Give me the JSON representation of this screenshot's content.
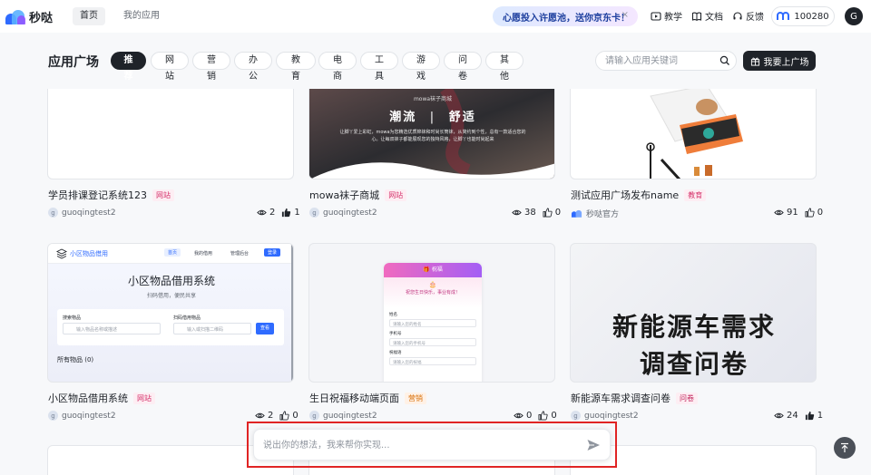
{
  "topbar": {
    "brand": "秒哒",
    "tabs": [
      {
        "label": "首页"
      },
      {
        "label": "我的应用"
      }
    ],
    "promo": "心愿投入许愿池，送你京东卡！",
    "promo_close": "×",
    "links": [
      {
        "label": "教学",
        "icon": "play-box-icon"
      },
      {
        "label": "文档",
        "icon": "book-icon"
      },
      {
        "label": "反馈",
        "icon": "headset-icon"
      }
    ],
    "credits": "100280",
    "avatar": "G"
  },
  "plaza": {
    "title": "应用广场",
    "categories": [
      {
        "label": "推荐"
      },
      {
        "label": "网站"
      },
      {
        "label": "营销"
      },
      {
        "label": "办公"
      },
      {
        "label": "教育"
      },
      {
        "label": "电商"
      },
      {
        "label": "工具"
      },
      {
        "label": "游戏"
      },
      {
        "label": "问卷"
      },
      {
        "label": "其他"
      }
    ],
    "search_placeholder": "请输入应用关键词",
    "cta": "我要上广场"
  },
  "cards": [
    {
      "title": "学员排课登记系统123",
      "tag": "网站",
      "author": "guoqingtest2",
      "views": "2",
      "likes": "1"
    },
    {
      "title": "mowa袜子商城",
      "tag": "网站",
      "author": "guoqingtest2",
      "views": "38",
      "likes": "0",
      "image_texts": {
        "small": "mowa袜子商城",
        "headline_left": "潮流",
        "headline_right": "舒适",
        "body": "让脚丫爱上彩虹，mowa为您精选优质棉袜和时尚长筒袜，从简约到个性，总有一款适合您的心。让每双袜子都能展现您的独特风格，让脚丫也能时尚起来"
      }
    },
    {
      "title": "测试应用广场发布name",
      "tag": "教育",
      "author": "秒哒官方",
      "views": "91",
      "likes": "0"
    },
    {
      "title": "小区物品借用系统",
      "tag": "网站",
      "author": "guoqingtest2",
      "views": "2",
      "likes": "0",
      "image_texts": {
        "app_name": "小区物品借用",
        "nav": [
          "首页",
          "我的借用",
          "管理后台",
          "登录"
        ],
        "heading": "小区物品借用系统",
        "subheading": "扫码借用，便民共享",
        "field1_label": "搜索物品",
        "field1_placeholder": "输入物品名称或描述",
        "field2_label": "扫码借用物品",
        "field2_placeholder": "输入或扫描二维码",
        "button": "查看",
        "section": "所有物品 (0)"
      }
    },
    {
      "title": "生日祝福移动端页面",
      "tag": "营销",
      "author": "guoqingtest2",
      "views": "0",
      "likes": "0",
      "image_texts": {
        "header": "祝福",
        "greeting": "祝您生日快乐，事业有成！",
        "name_label": "姓名",
        "name_placeholder": "请输入您的姓名",
        "phone_label": "手机号",
        "phone_placeholder": "请输入您的手机号",
        "wish_label": "祝福语",
        "wish_placeholder": "请输入您的祝福"
      }
    },
    {
      "title": "新能源车需求调查问卷",
      "tag": "问卷",
      "author": "guoqingtest2",
      "views": "24",
      "likes": "1",
      "image_texts": {
        "line1": "新能源车需求",
        "line2": "调查问卷"
      }
    }
  ],
  "prompt": {
    "placeholder": "说出你的想法，我来帮你实现..."
  },
  "colors": {
    "accent": "#1f2329",
    "highlight": "#e02424",
    "link_blue": "#2f6bff"
  }
}
